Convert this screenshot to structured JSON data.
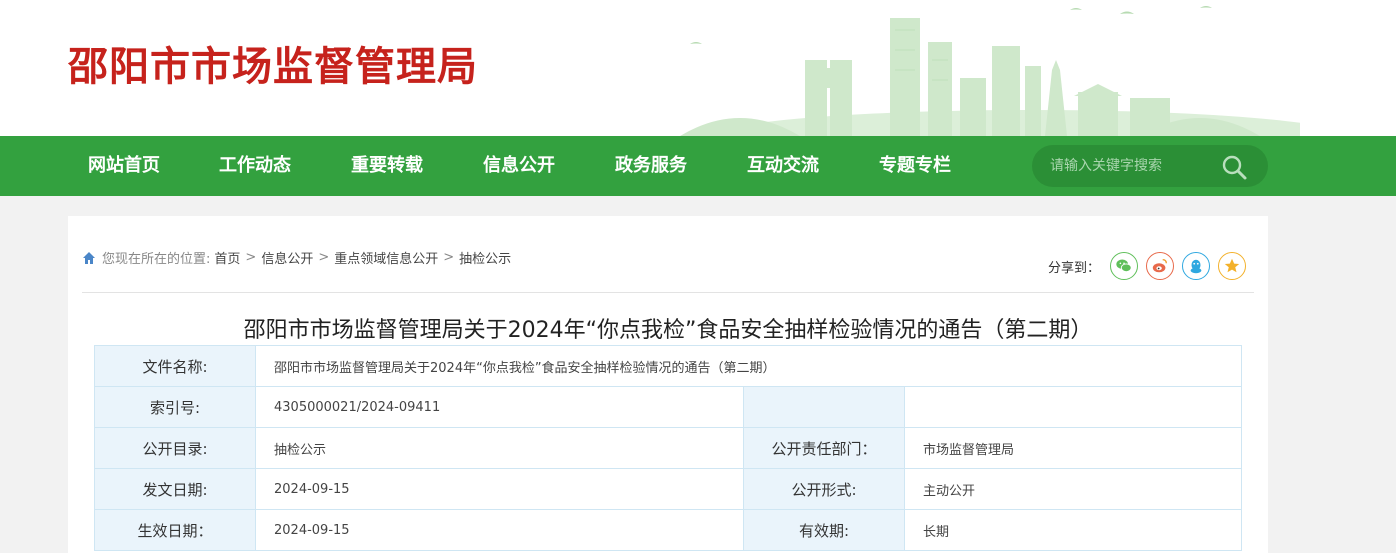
{
  "site": {
    "title": "邵阳市市场监督管理局"
  },
  "nav": {
    "items": [
      "网站首页",
      "工作动态",
      "重要转载",
      "信息公开",
      "政务服务",
      "互动交流",
      "专题专栏"
    ],
    "search_placeholder": "请输入关键字搜索"
  },
  "breadcrumb": {
    "prefix": "您现在所在的位置:",
    "items": [
      "首页",
      "信息公开",
      "重点领域信息公开",
      "抽检公示"
    ],
    "separator": ">"
  },
  "share": {
    "label": "分享到：",
    "targets": [
      "wechat-icon",
      "weibo-icon",
      "qq-icon",
      "qzone-icon"
    ]
  },
  "article": {
    "title": "邵阳市市场监督管理局关于2024年“你点我检”食品安全抽样检验情况的通告（第二期）"
  },
  "meta": {
    "file_name_label": "文件名称:",
    "file_name": "邵阳市市场监督管理局关于2024年“你点我检”食品安全抽样检验情况的通告（第二期）",
    "index_label": "索引号:",
    "index": "4305000021/2024-09411",
    "catalog_label": "公开目录:",
    "catalog": "抽检公示",
    "dept_label": "公开责任部门：",
    "dept": "市场监督管理局",
    "issue_date_label": "发文日期:",
    "issue_date": "2024-09-15",
    "form_label": "公开形式:",
    "form": "主动公开",
    "effective_date_label": "生效日期：",
    "effective_date": "2024-09-15",
    "validity_label": "有效期:",
    "validity": "长期"
  },
  "colors": {
    "brand_red": "#c6221c",
    "nav_green": "#33a13f",
    "table_border": "#cfe6f3",
    "table_label_bg": "#eaf4fb"
  }
}
